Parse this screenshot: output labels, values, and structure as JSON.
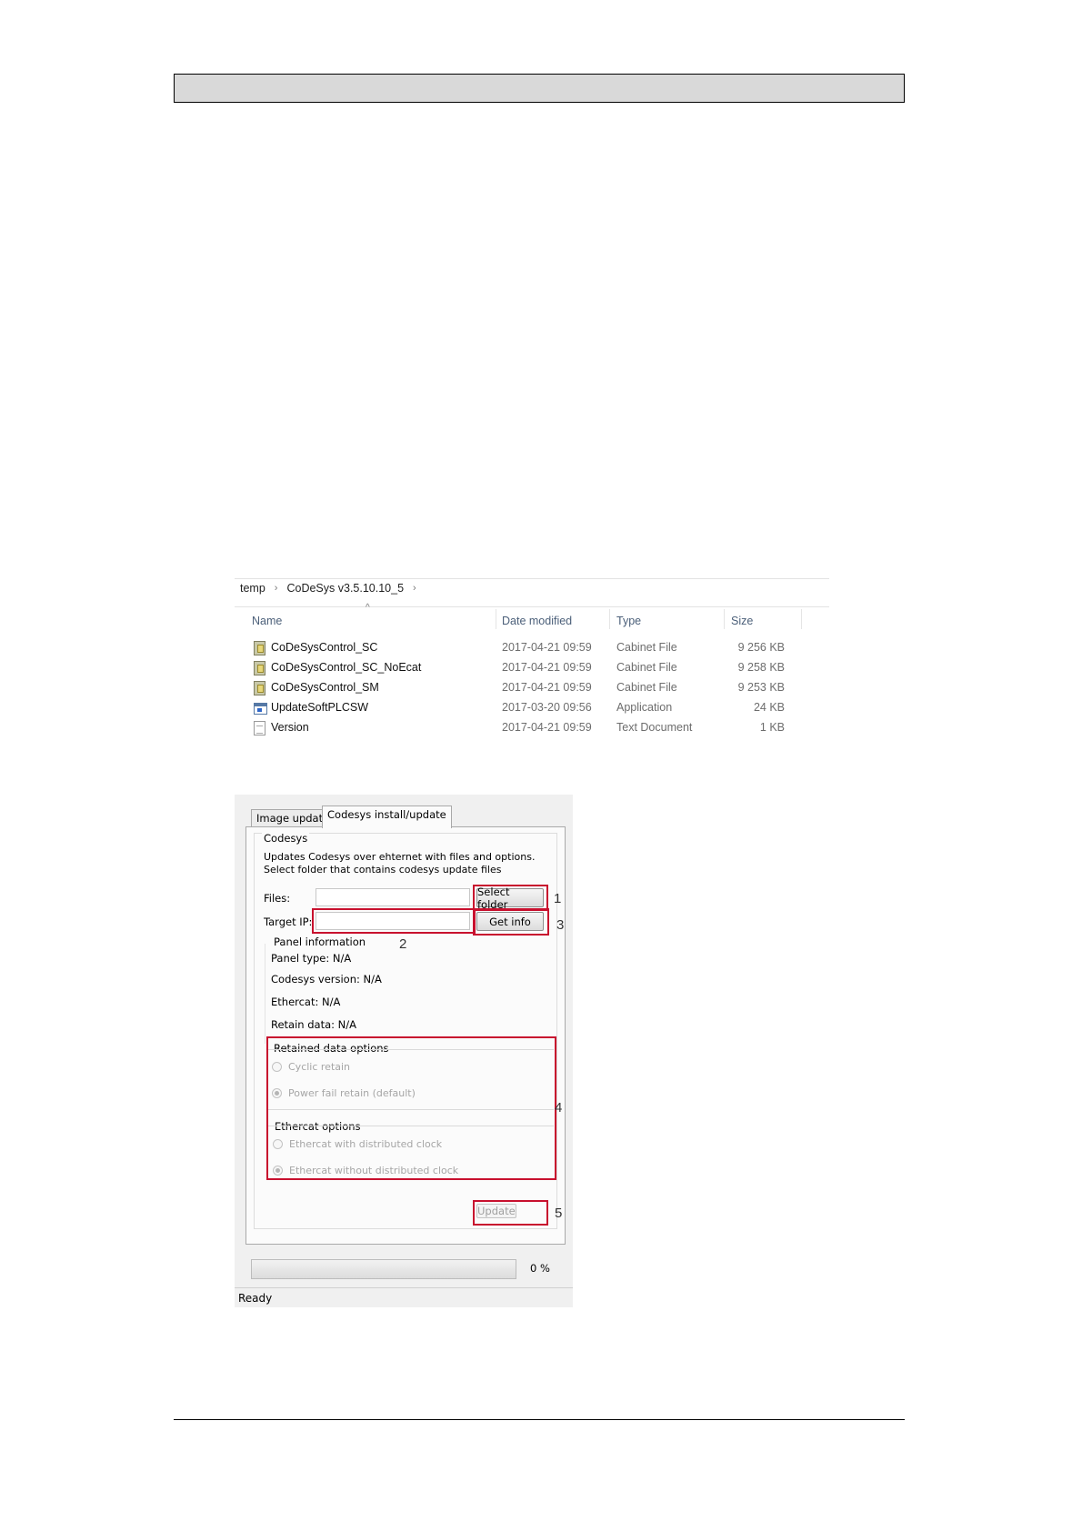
{
  "page": {
    "header_text": "",
    "footer_text": ""
  },
  "explorer": {
    "breadcrumb": [
      "temp",
      "CoDeSys v3.5.10.10_5"
    ],
    "breadcrumb_separator": "›",
    "sort_indicator": "^",
    "columns": [
      "Name",
      "Date modified",
      "Type",
      "Size"
    ],
    "files": [
      {
        "icon": "cabinet-file-icon",
        "name": "CoDeSysControl_SC",
        "date": "2017-04-21 09:59",
        "type": "Cabinet File",
        "size": "9 256 KB"
      },
      {
        "icon": "cabinet-file-icon",
        "name": "CoDeSysControl_SC_NoEcat",
        "date": "2017-04-21 09:59",
        "type": "Cabinet File",
        "size": "9 258 KB"
      },
      {
        "icon": "cabinet-file-icon",
        "name": "CoDeSysControl_SM",
        "date": "2017-04-21 09:59",
        "type": "Cabinet File",
        "size": "9 253 KB"
      },
      {
        "icon": "application-icon",
        "name": "UpdateSoftPLCSW",
        "date": "2017-03-20 09:56",
        "type": "Application",
        "size": "24 KB"
      },
      {
        "icon": "text-document-icon",
        "name": "Version",
        "date": "2017-04-21 09:59",
        "type": "Text Document",
        "size": "1 KB"
      }
    ]
  },
  "installer": {
    "tabs": [
      {
        "label": "Image update",
        "active": false
      },
      {
        "label": "Codesys install/update",
        "active": true
      }
    ],
    "group_title": "Codesys",
    "description": "Updates Codesys over ehternet with files and options. Select folder that contains codesys update files",
    "files_label": "Files:",
    "files_value": "",
    "select_folder_label": "Select folder",
    "target_ip_label": "Target IP:",
    "target_ip_value": "",
    "get_info_label": "Get info",
    "panel_info_title": "Panel information",
    "panel_type": "Panel type: N/A",
    "codesys_version": "Codesys version: N/A",
    "ethercat": "Ethercat: N/A",
    "retain_data": "Retain data: N/A",
    "retained_options_title": "Retained data options",
    "retained_options": [
      {
        "label": "Cyclic retain",
        "checked": false
      },
      {
        "label": "Power fail retain (default)",
        "checked": true
      }
    ],
    "ethercat_options_title": "Ethercat options",
    "ethercat_options": [
      {
        "label": "Ethercat with distributed clock",
        "checked": false
      },
      {
        "label": "Ethercat without distributed clock",
        "checked": true
      }
    ],
    "update_label": "Update",
    "progress_fraction": 0,
    "progress_text": "0 %",
    "status_text": "Ready"
  },
  "annotations": {
    "highlight_color": "#c8102e",
    "callouts": [
      "1",
      "2",
      "3",
      "4",
      "5"
    ]
  }
}
